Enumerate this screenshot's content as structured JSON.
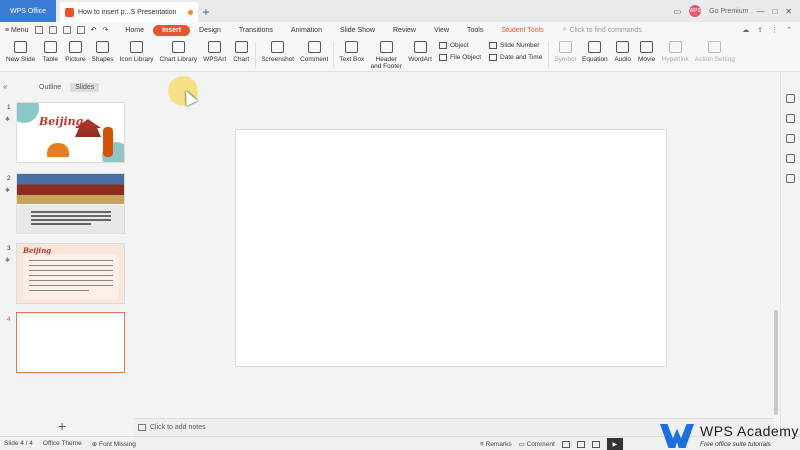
{
  "titlebar": {
    "app_tab": "WPS Office",
    "doc_tab": "How to insert p...S Presentation",
    "new_tab": "+",
    "avatar": "WPS",
    "go_premium": "Go Premium",
    "window_controls": [
      "—",
      "□",
      "✕"
    ]
  },
  "menu": {
    "menu_label": "Menu",
    "tabs": [
      {
        "label": "Home",
        "active": false
      },
      {
        "label": "Insert",
        "active": true
      },
      {
        "label": "Design",
        "active": false
      },
      {
        "label": "Transitions",
        "active": false
      },
      {
        "label": "Animation",
        "active": false
      },
      {
        "label": "Slide Show",
        "active": false
      },
      {
        "label": "Review",
        "active": false
      },
      {
        "label": "View",
        "active": false
      },
      {
        "label": "Tools",
        "active": false
      },
      {
        "label": "Student Tools",
        "active": false
      }
    ],
    "search_placeholder": "Click to find commands"
  },
  "ribbon": {
    "new_slide": "New Slide",
    "table": "Table",
    "picture": "Picture",
    "shapes": "Shapes",
    "icon_library": "Icon Library",
    "chart_library": "Chart Library",
    "wpsart": "WPSArt",
    "chart": "Chart",
    "screenshot": "Screenshot",
    "comment": "Comment",
    "text_box": "Text Box",
    "header_footer": "Header and Footer",
    "wordart": "WordArt",
    "object": "Object",
    "file_object": "File Object",
    "slide_number": "Slide Number",
    "date_time": "Date and Time",
    "symbol": "Symbol",
    "equation": "Equation",
    "audio": "Audio",
    "movie": "Movie",
    "hyperlink": "Hyperlink",
    "action_setting": "Action Setting"
  },
  "leftpane": {
    "outline_tab": "Outline",
    "slides_tab": "Slides",
    "slide_numbers": [
      "1",
      "2",
      "3",
      "4"
    ],
    "slide1_title": "Beijing",
    "slide3_title": "Beijing",
    "add_slide": "+"
  },
  "notes": {
    "placeholder": "Click to add notes"
  },
  "status": {
    "slide_info": "Slide 4 / 4",
    "theme": "Office Theme",
    "font_missing": "Font Missing",
    "remarks": "Remarks",
    "comment": "Comment"
  },
  "watermark": {
    "title": "WPS Academy",
    "subtitle": "Free office suite tutorials"
  },
  "colors": {
    "accent": "#e8542f",
    "wps_blue": "#3a7bd5",
    "brand_blue": "#1d6fe0"
  }
}
